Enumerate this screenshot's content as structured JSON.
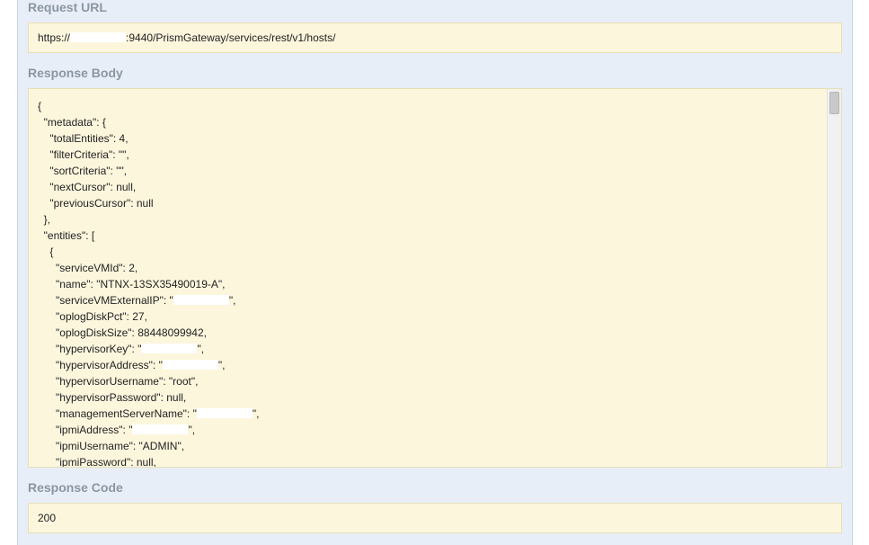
{
  "request_url": {
    "label": "Request URL",
    "prefix": "https://",
    "suffix": ":9440/PrismGateway/services/rest/v1/hosts/"
  },
  "response_body": {
    "label": "Response Body",
    "lines": [
      "{",
      "  \"metadata\": {",
      "    \"totalEntities\": 4,",
      "    \"filterCriteria\": \"\",",
      "    \"sortCriteria\": \"\",",
      "    \"nextCursor\": null,",
      "    \"previousCursor\": null",
      "  },",
      "  \"entities\": [",
      "    {",
      "      \"serviceVMId\": 2,",
      "      \"name\": \"NTNX-13SX35490019-A\",",
      "      \"serviceVMExternalIP\": \"",
      "      \"oplogDiskPct\": 27,",
      "      \"oplogDiskSize\": 88448099942,",
      "      \"hypervisorKey\": \"",
      "      \"hypervisorAddress\": \"",
      "      \"hypervisorUsername\": \"root\",",
      "      \"hypervisorPassword\": null,",
      "      \"managementServerName\": \"",
      "      \"ipmiAddress\": \"",
      "      \"ipmiUsername\": \"ADMIN\",",
      "      \"ipmiPassword\": null,"
    ],
    "redacted_line_tails": {
      "12": "\",",
      "15": "\",",
      "16": "\",",
      "19": "\",",
      "20": "\","
    }
  },
  "response_code": {
    "label": "Response Code",
    "value": "200"
  }
}
